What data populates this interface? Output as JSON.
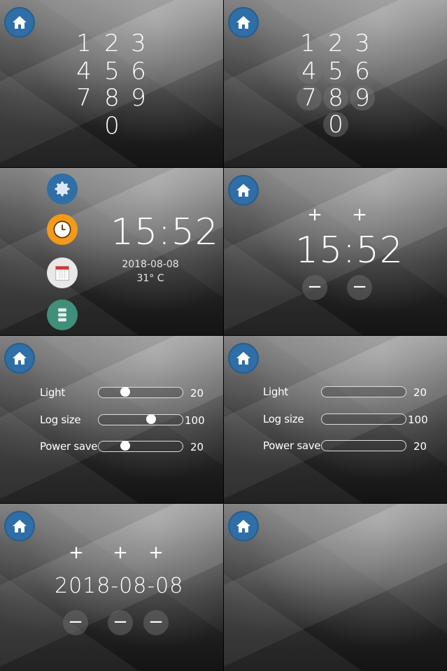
{
  "keypad": {
    "digits": [
      "1",
      "2",
      "3",
      "4",
      "5",
      "6",
      "7",
      "8",
      "9",
      "0"
    ]
  },
  "menu": {
    "icons": [
      "gear-icon",
      "clock-icon",
      "calendar-icon",
      "storage-icon"
    ]
  },
  "clock": {
    "time": "15:52",
    "date": "2018-08-08",
    "temperature": "31° C"
  },
  "time_editor": {
    "time": "15:52",
    "plus": "+",
    "minus": "−"
  },
  "settings": {
    "rows": [
      {
        "label": "Light",
        "value": "20",
        "level": 0.2
      },
      {
        "label": "Log size",
        "value": "100",
        "level": 0.55
      },
      {
        "label": "Power save",
        "value": "20",
        "level": 0.2
      }
    ]
  },
  "date_editor": {
    "date": "2018-08-08",
    "plus": "+",
    "minus": "−"
  },
  "colors": {
    "home": "#2f6ea6",
    "clock_orange": "#f39a1a",
    "storage_teal": "#3f8f7a",
    "gear_blue": "#2f6ea6"
  }
}
